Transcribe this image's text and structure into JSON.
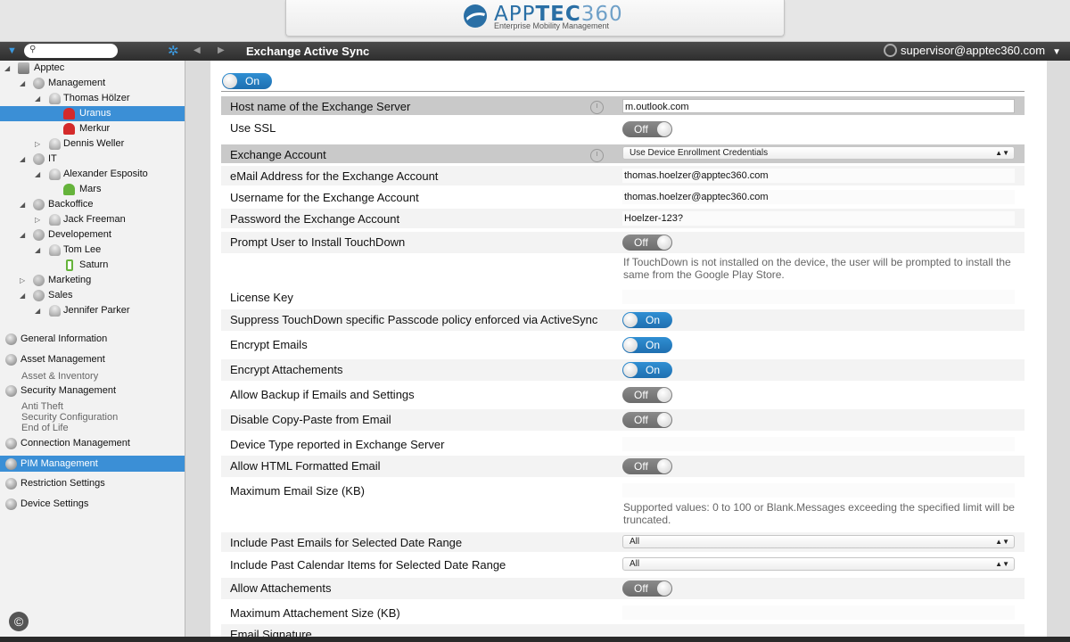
{
  "brand": {
    "name_light": "APP",
    "name_bold": "TEC",
    "name_num": "360",
    "tagline": "Enterprise Mobility Management"
  },
  "navbar": {
    "title": "Exchange Active Sync",
    "user": "supervisor@apptec360.com"
  },
  "tree": [
    {
      "label": "Apptec"
    },
    {
      "label": "Management"
    },
    {
      "label": "Thomas Hölzer"
    },
    {
      "label": "Uranus"
    },
    {
      "label": "Merkur"
    },
    {
      "label": "Dennis Weller"
    },
    {
      "label": "IT"
    },
    {
      "label": "Alexander Esposito"
    },
    {
      "label": "Mars"
    },
    {
      "label": "Backoffice"
    },
    {
      "label": "Jack Freeman"
    },
    {
      "label": "Developement"
    },
    {
      "label": "Tom Lee"
    },
    {
      "label": "Saturn"
    },
    {
      "label": "Marketing"
    },
    {
      "label": "Sales"
    },
    {
      "label": "Jennifer Parker"
    }
  ],
  "menu": {
    "general": "General Information",
    "asset": "Asset Management",
    "asset_sub": "Asset & Inventory",
    "security": "Security Management",
    "security_sub1": "Anti Theft",
    "security_sub2": "Security Configuration",
    "security_sub3": "End of Life",
    "connection": "Connection Management",
    "pim": "PIM Management",
    "restriction": "Restriction Settings",
    "device": "Device Settings"
  },
  "copyright": "©",
  "toggles": {
    "on": "On",
    "off": "Off"
  },
  "form": {
    "enabled": "On",
    "host_label": "Host name of the Exchange Server",
    "host_value": "m.outlook.com",
    "ssl_label": "Use SSL",
    "account_label": "Exchange Account",
    "account_value": "Use Device Enrollment Credentials",
    "email_label": "eMail Address for the Exchange Account",
    "email_value": "thomas.hoelzer@apptec360.com",
    "username_label": "Username for the Exchange Account",
    "username_value": "thomas.hoelzer@apptec360.com",
    "password_label": "Password the Exchange Account",
    "password_value": "Hoelzer-123?",
    "prompt_label": "Prompt User to Install TouchDown",
    "prompt_help": "If TouchDown is not installed on the device, the user will be prompted to install the same from the Google Play Store.",
    "license_label": "License Key",
    "suppress_label": "Suppress TouchDown specific Passcode policy enforced via ActiveSync",
    "encrypt_emails_label": "Encrypt Emails",
    "encrypt_attach_label": "Encrypt Attachements",
    "backup_label": "Allow Backup if Emails and Settings",
    "copypaste_label": "Disable Copy-Paste from Email",
    "devtype_label": "Device Type reported in Exchange Server",
    "html_label": "Allow HTML Formatted Email",
    "maxsize_label": "Maximum Email Size (KB)",
    "maxsize_help": "Supported values: 0 to 100 or Blank.Messages exceeding the specified limit will be truncated.",
    "past_emails_label": "Include Past Emails for Selected Date Range",
    "past_emails_value": "All",
    "past_cal_label": "Include Past Calendar Items for Selected Date Range",
    "past_cal_value": "All",
    "allow_attach_label": "Allow Attachements",
    "max_attach_label": "Maximum Attachement Size (KB)",
    "signature_label": "Email Signature"
  }
}
